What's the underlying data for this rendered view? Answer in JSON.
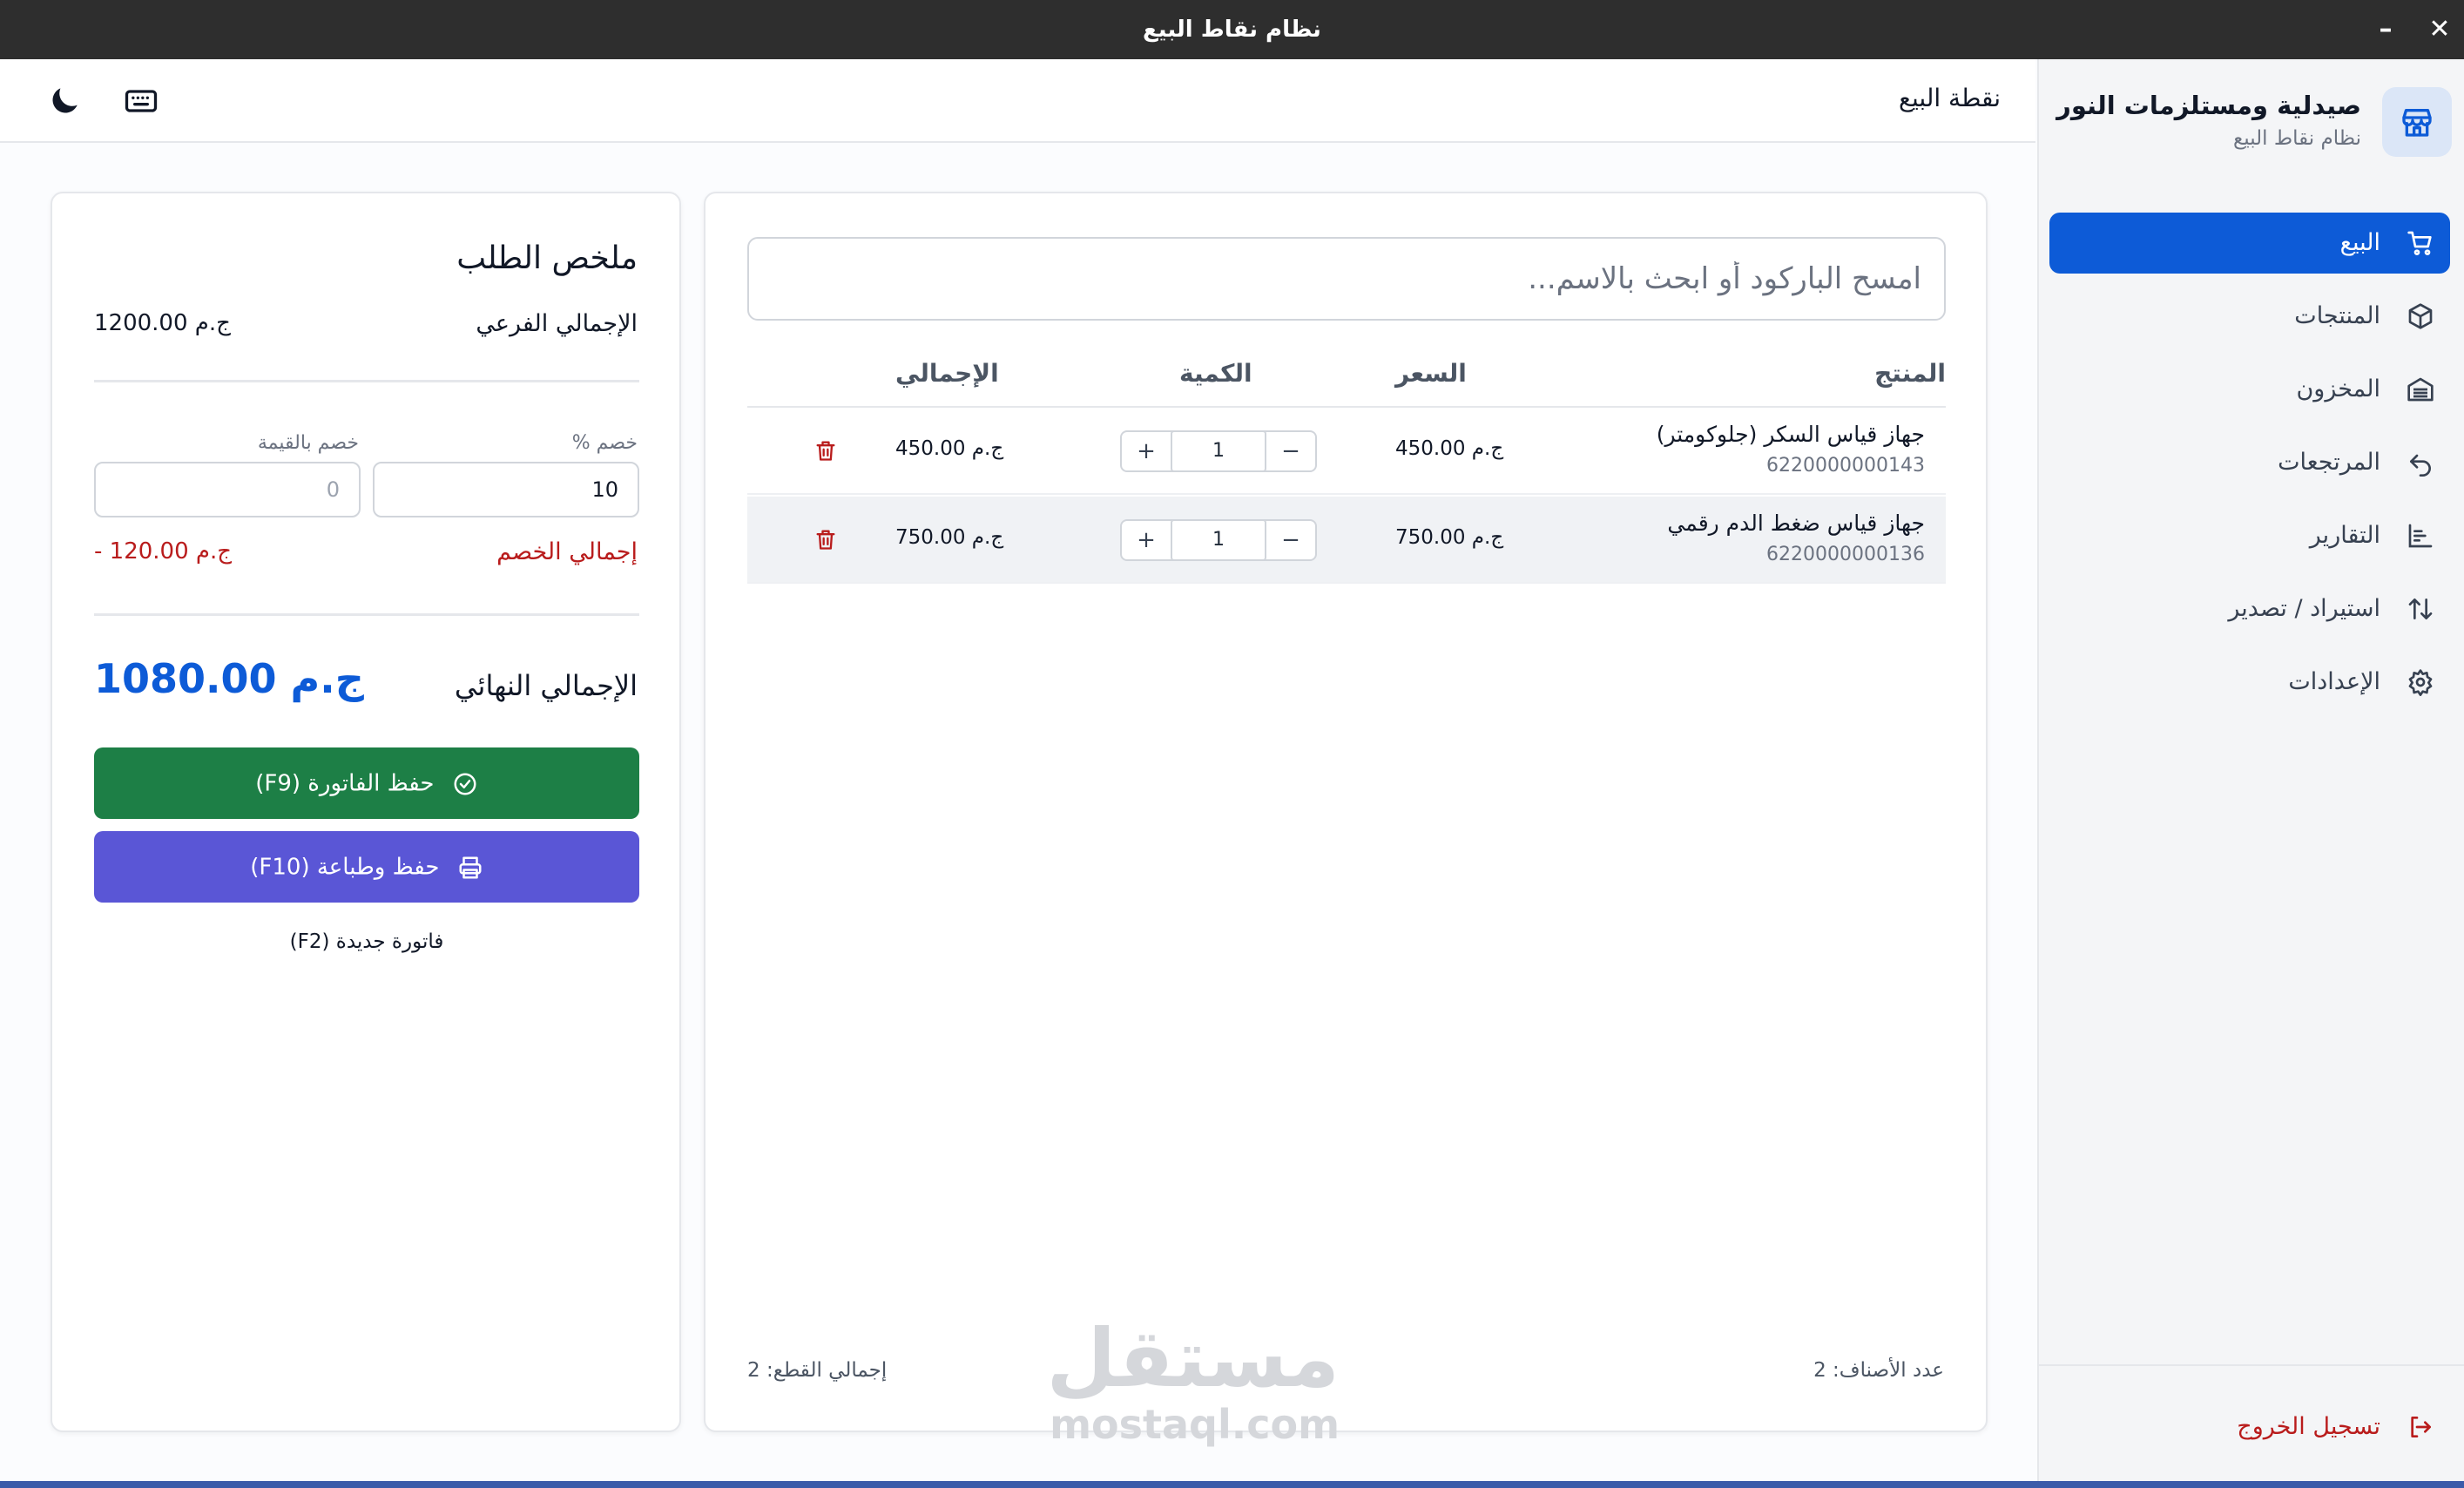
{
  "window": {
    "title": "نظام نقاط البيع",
    "close_label": "✕",
    "minimize_label": "–"
  },
  "brand": {
    "name": "صيدلية ومستلزمات النور",
    "subtitle": "نظام نقاط البيع",
    "icon": "store-icon"
  },
  "sidebar": {
    "items": [
      {
        "label": "البيع",
        "icon": "cart-icon",
        "active": true
      },
      {
        "label": "المنتجات",
        "icon": "box-icon",
        "active": false
      },
      {
        "label": "المخزون",
        "icon": "warehouse-icon",
        "active": false
      },
      {
        "label": "المرتجعات",
        "icon": "undo-icon",
        "active": false
      },
      {
        "label": "التقارير",
        "icon": "chart-icon",
        "active": false
      },
      {
        "label": "استيراد / تصدير",
        "icon": "swap-icon",
        "active": false
      },
      {
        "label": "الإعدادات",
        "icon": "gear-icon",
        "active": false
      }
    ],
    "logout_label": "تسجيل الخروج"
  },
  "header": {
    "title": "نقطة البيع"
  },
  "cart": {
    "search_placeholder": "امسح الباركود أو ابحث بالاسم...",
    "columns": {
      "product": "المنتج",
      "price": "السعر",
      "qty": "الكمية",
      "total": "الإجمالي"
    },
    "rows": [
      {
        "name": "جهاز قياس السكر (جلوكومتر)",
        "code": "6220000000143",
        "price": "450.00 ج.م",
        "qty": "1",
        "total": "450.00 ج.م"
      },
      {
        "name": "جهاز قياس ضغط الدم رقمي",
        "code": "6220000000136",
        "price": "750.00 ج.م",
        "qty": "1",
        "total": "750.00 ج.م"
      }
    ],
    "qty_plus": "+",
    "qty_minus": "−",
    "items_count": "عدد الأصناف: 2",
    "pieces_total": "إجمالي القطع: 2",
    "watermark_ar": "مستقل",
    "watermark_en": "mostaql.com"
  },
  "summary": {
    "title": "ملخص الطلب",
    "subtotal_label": "الإجمالي الفرعي",
    "subtotal_value": "1200.00 ج.م",
    "discount_pct_label": "خصم %",
    "discount_pct_value": "10",
    "discount_amount_label": "خصم بالقيمة",
    "discount_amount_value": "0",
    "discount_total_label": "إجمالي الخصم",
    "discount_total_value": "- 120.00 ج.م",
    "final_label": "الإجمالي النهائي",
    "final_value": "1080.00 ج.م",
    "save_button": "حفظ الفاتورة (F9)",
    "save_print_button": "حفظ وطباعة (F10)",
    "new_invoice": "فاتورة جديدة (F2)"
  },
  "colors": {
    "accent": "#0d5bd7",
    "success": "#1d7f46",
    "print": "#5a56d6",
    "danger": "#b91c1c"
  }
}
